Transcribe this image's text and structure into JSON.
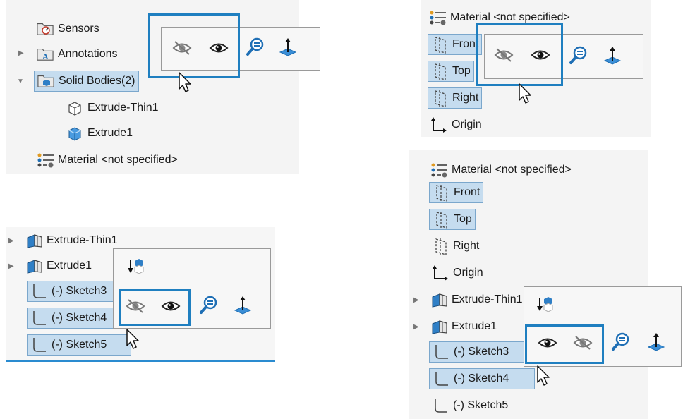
{
  "panel_a": {
    "items": [
      {
        "label": "Sensors",
        "icon": "sensors-folder-icon"
      },
      {
        "label": "Annotations",
        "icon": "annotations-folder-icon"
      },
      {
        "label": "Solid Bodies(2)",
        "icon": "solid-bodies-folder-icon"
      },
      {
        "label": "Extrude-Thin1",
        "icon": "thin-body-icon"
      },
      {
        "label": "Extrude1",
        "icon": "solid-body-icon"
      },
      {
        "label": "Material <not specified>",
        "icon": "material-icon"
      }
    ]
  },
  "panel_b": {
    "items": [
      {
        "label": "Material <not specified>",
        "icon": "material-icon"
      },
      {
        "label": "Front",
        "icon": "plane-icon"
      },
      {
        "label": "Top",
        "icon": "plane-icon"
      },
      {
        "label": "Right",
        "icon": "plane-icon"
      },
      {
        "label": "Origin",
        "icon": "origin-icon"
      }
    ]
  },
  "panel_c": {
    "items": [
      {
        "label": "Extrude-Thin1",
        "icon": "feature-icon"
      },
      {
        "label": "Extrude1",
        "icon": "feature-icon"
      },
      {
        "label": "(-) Sketch3",
        "icon": "sketch-icon"
      },
      {
        "label": "(-) Sketch4",
        "icon": "sketch-icon"
      },
      {
        "label": "(-) Sketch5",
        "icon": "sketch-icon"
      }
    ]
  },
  "panel_d": {
    "items": [
      {
        "label": "Material <not specified>",
        "icon": "material-icon"
      },
      {
        "label": "Front",
        "icon": "plane-icon"
      },
      {
        "label": "Top",
        "icon": "plane-icon"
      },
      {
        "label": "Right",
        "icon": "plane-icon"
      },
      {
        "label": "Origin",
        "icon": "origin-icon"
      },
      {
        "label": "Extrude-Thin1",
        "icon": "feature-icon"
      },
      {
        "label": "Extrude1",
        "icon": "feature-icon"
      },
      {
        "label": "(-) Sketch3",
        "icon": "sketch-icon"
      },
      {
        "label": "(-) Sketch4",
        "icon": "sketch-icon"
      },
      {
        "label": "(-) Sketch5",
        "icon": "sketch-icon"
      }
    ]
  },
  "toolbar_icons": [
    "hide-icon",
    "show-icon",
    "zoom-to-selection-icon",
    "normal-to-icon",
    "insert-into-icon"
  ],
  "colors": {
    "highlight": "#1f7fc0",
    "selection": "#c5dcef",
    "accent": "#2a8bd0"
  }
}
